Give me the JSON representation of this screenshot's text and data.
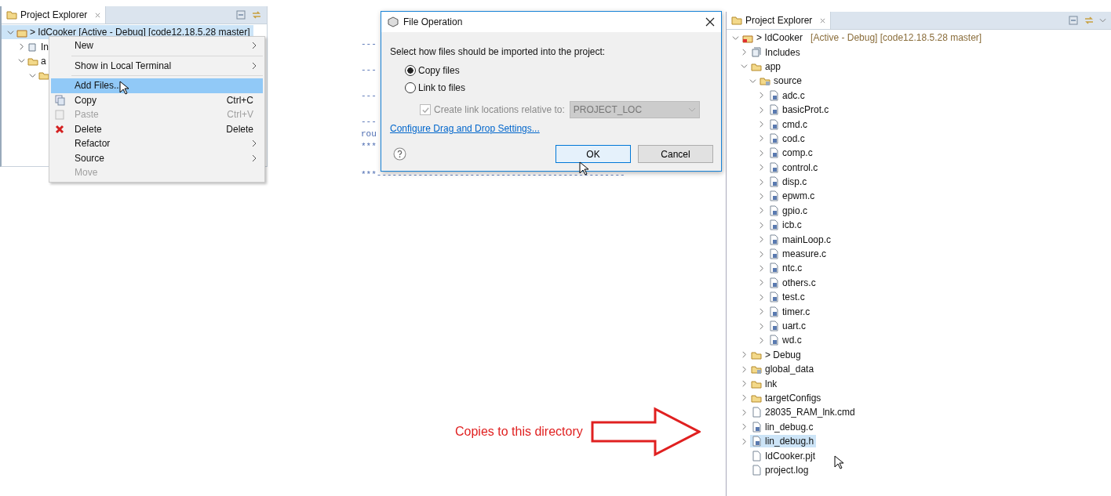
{
  "left_explorer": {
    "title": "Project Explorer",
    "tree": [
      {
        "label": "> IdCooker  [Active - Debug] [code12.18.5.28 master]",
        "kind": "project",
        "expanded": true,
        "selected": true,
        "children": [
          {
            "label": "In",
            "kind": "includes",
            "expanded": false,
            "selected": false
          },
          {
            "label": "a",
            "kind": "folder",
            "expanded": true,
            "selected": false,
            "children": [
              {
                "kind": "source-folder",
                "expanded": true,
                "selected": false
              }
            ]
          }
        ]
      }
    ]
  },
  "context_menu": [
    {
      "kind": "item",
      "label": "New",
      "submenu": true,
      "disabled": false,
      "selected": false
    },
    {
      "kind": "separator"
    },
    {
      "kind": "item",
      "label": "Show in Local Terminal",
      "submenu": true,
      "disabled": false,
      "selected": false
    },
    {
      "kind": "separator"
    },
    {
      "kind": "item",
      "label": "Add Files...",
      "submenu": false,
      "disabled": false,
      "selected": true
    },
    {
      "kind": "copy",
      "label": "Copy",
      "shortcut": "Ctrl+C",
      "submenu": false,
      "disabled": false,
      "selected": false
    },
    {
      "kind": "paste",
      "label": "Paste",
      "shortcut": "Ctrl+V",
      "submenu": false,
      "disabled": true,
      "selected": false
    },
    {
      "kind": "delete",
      "label": "Delete",
      "shortcut": "Delete",
      "submenu": false,
      "disabled": false,
      "selected": false
    },
    {
      "kind": "item",
      "label": "Refactor",
      "submenu": true,
      "disabled": false,
      "selected": false
    },
    {
      "kind": "item",
      "label": "Source",
      "submenu": true,
      "disabled": false,
      "selected": false
    },
    {
      "kind": "item",
      "label": "Move",
      "submenu": false,
      "disabled": true,
      "selected": false
    }
  ],
  "code_lines": [
    "---",
    "---",
    "---",
    "---",
    "rou",
    "***"
  ],
  "code_last_line": "***------------------------------------------------",
  "dialog": {
    "title": "File Operation",
    "prompt": "Select how files should be imported into the project:",
    "options": [
      {
        "label": "Copy files",
        "selected": true
      },
      {
        "label": "Link to files",
        "selected": false
      }
    ],
    "relative": {
      "label": "Create link locations relative to:",
      "checked": true,
      "disabled": true
    },
    "location": {
      "value": "PROJECT_LOC",
      "disabled": true
    },
    "link": "Configure Drag and Drop Settings...",
    "buttons": [
      {
        "label": "OK",
        "focused": true
      },
      {
        "label": "Cancel",
        "focused": false
      }
    ]
  },
  "annotation": {
    "text": "Copies to this directory"
  },
  "right_explorer": {
    "title": "Project Explorer",
    "tree": [
      {
        "label": "> IdCooker",
        "detail": "[Active - Debug] [code12.18.5.28 master]",
        "kind": "project",
        "expanded": true,
        "selected": false,
        "children": [
          {
            "label": "Includes",
            "kind": "includes",
            "expanded": false,
            "selected": false
          },
          {
            "label": "app",
            "kind": "folder",
            "expanded": true,
            "selected": false,
            "children": [
              {
                "label": "source",
                "kind": "source-folder",
                "expanded": true,
                "selected": false,
                "children": [
                  {
                    "label": "adc.c",
                    "kind": "c-file",
                    "expanded": false,
                    "selected": false
                  },
                  {
                    "label": "basicProt.c",
                    "kind": "c-file",
                    "expanded": false,
                    "selected": false
                  },
                  {
                    "label": "cmd.c",
                    "kind": "c-file",
                    "expanded": false,
                    "selected": false
                  },
                  {
                    "label": "cod.c",
                    "kind": "c-file",
                    "expanded": false,
                    "selected": false
                  },
                  {
                    "label": "comp.c",
                    "kind": "c-file",
                    "expanded": false,
                    "selected": false
                  },
                  {
                    "label": "control.c",
                    "kind": "c-file",
                    "expanded": false,
                    "selected": false
                  },
                  {
                    "label": "disp.c",
                    "kind": "c-file",
                    "expanded": false,
                    "selected": false
                  },
                  {
                    "label": "epwm.c",
                    "kind": "c-file",
                    "expanded": false,
                    "selected": false
                  },
                  {
                    "label": "gpio.c",
                    "kind": "c-file",
                    "expanded": false,
                    "selected": false
                  },
                  {
                    "label": "icb.c",
                    "kind": "c-file",
                    "expanded": false,
                    "selected": false
                  },
                  {
                    "label": "mainLoop.c",
                    "kind": "c-file",
                    "expanded": false,
                    "selected": false
                  },
                  {
                    "label": "measure.c",
                    "kind": "c-file",
                    "expanded": false,
                    "selected": false
                  },
                  {
                    "label": "ntc.c",
                    "kind": "c-file",
                    "expanded": false,
                    "selected": false
                  },
                  {
                    "label": "others.c",
                    "kind": "c-file",
                    "expanded": false,
                    "selected": false
                  },
                  {
                    "label": "test.c",
                    "kind": "c-file",
                    "expanded": false,
                    "selected": false
                  },
                  {
                    "label": "timer.c",
                    "kind": "c-file",
                    "expanded": false,
                    "selected": false
                  },
                  {
                    "label": "uart.c",
                    "kind": "c-file",
                    "expanded": false,
                    "selected": false
                  },
                  {
                    "label": "wd.c",
                    "kind": "c-file",
                    "expanded": false,
                    "selected": false
                  }
                ]
              }
            ]
          },
          {
            "label": "> Debug",
            "kind": "folder",
            "expanded": false,
            "selected": false
          },
          {
            "label": "global_data",
            "kind": "source-folder",
            "expanded": false,
            "selected": false
          },
          {
            "label": "lnk",
            "kind": "folder",
            "expanded": false,
            "selected": false
          },
          {
            "label": "targetConfigs",
            "kind": "folder",
            "expanded": false,
            "selected": false
          },
          {
            "label": "28035_RAM_lnk.cmd",
            "kind": "file",
            "expanded": false,
            "selected": false
          },
          {
            "label": "lin_debug.c",
            "kind": "c-file",
            "expanded": false,
            "selected": false
          },
          {
            "label": "lin_debug.h",
            "kind": "c-file",
            "expanded": false,
            "selected": true
          },
          {
            "label": "IdCooker.pjt",
            "kind": "file",
            "selected": false
          },
          {
            "label": "project.log",
            "kind": "file",
            "selected": false
          }
        ]
      }
    ]
  }
}
